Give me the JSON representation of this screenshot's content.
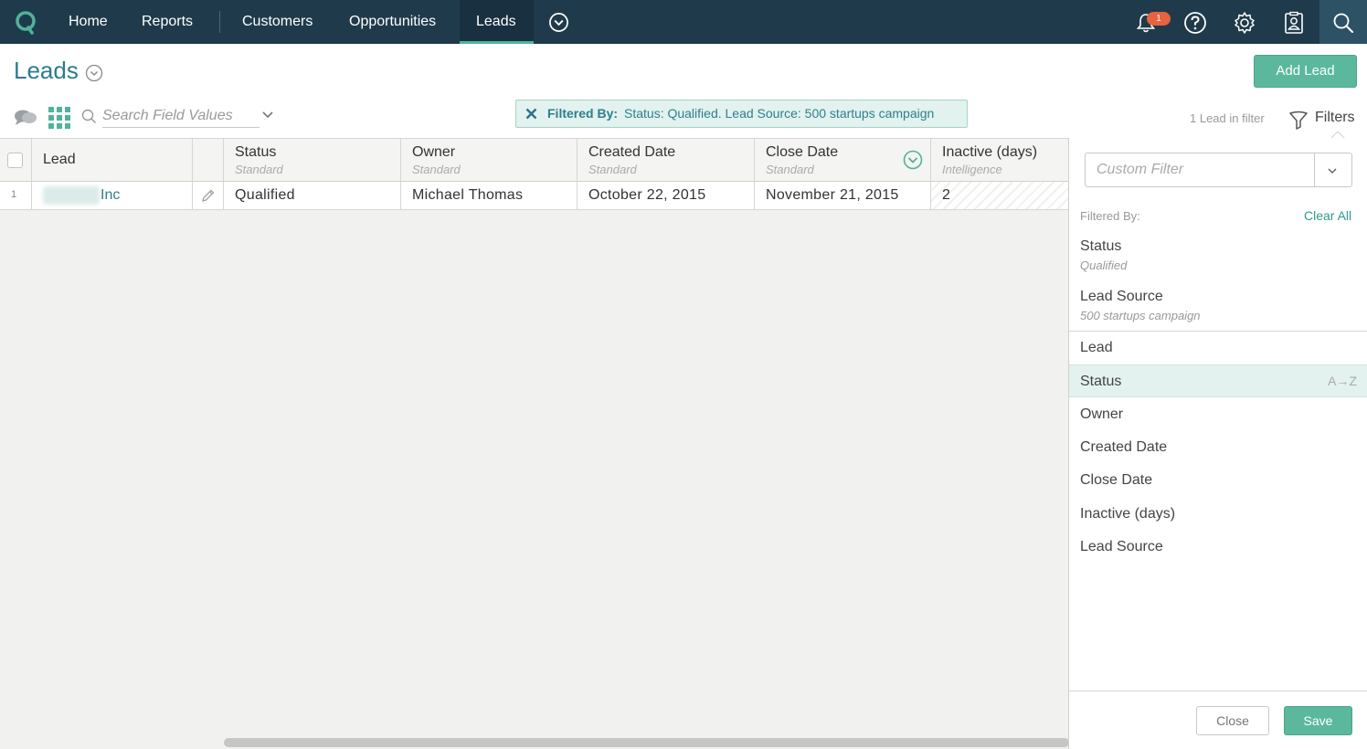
{
  "nav": {
    "items": [
      {
        "label": "Home"
      },
      {
        "label": "Reports"
      },
      {
        "label": "Customers"
      },
      {
        "label": "Opportunities"
      },
      {
        "label": "Leads",
        "active": true
      }
    ],
    "notification_count": "1",
    "icons": [
      "more-icon",
      "bell-icon",
      "help-icon",
      "gear-icon",
      "contact-card-icon",
      "search-icon"
    ]
  },
  "page": {
    "title": "Leads",
    "add_button": "Add Lead"
  },
  "toolbar": {
    "search_placeholder": "Search Field Values",
    "filter_chip_label": "Filtered By:",
    "filter_chip_text": "Status: Qualified. Lead Source: 500 startups campaign",
    "count_text": "1 Lead in filter",
    "filters_label": "Filters"
  },
  "table": {
    "columns": [
      {
        "title": "Lead",
        "sub": ""
      },
      {
        "title": "Status",
        "sub": "Standard"
      },
      {
        "title": "Owner",
        "sub": "Standard"
      },
      {
        "title": "Created Date",
        "sub": "Standard"
      },
      {
        "title": "Close Date",
        "sub": "Standard"
      },
      {
        "title": "Inactive (days)",
        "sub": "Intelligence"
      }
    ],
    "rows": [
      {
        "num": "1",
        "lead": "Inc",
        "status": "Qualified",
        "owner": "Michael Thomas",
        "created": "October 22, 2015",
        "close": "November 21, 2015",
        "inactive": "2"
      }
    ]
  },
  "filter_panel": {
    "custom_filter_placeholder": "Custom Filter",
    "filtered_by_label": "Filtered By:",
    "clear_all": "Clear All",
    "active_filters": [
      {
        "field": "Status",
        "value": "Qualified"
      },
      {
        "field": "Lead Source",
        "value": "500 startups campaign"
      }
    ],
    "columns": [
      "Lead",
      "Status",
      "Owner",
      "Created Date",
      "Close Date",
      "Inactive (days)",
      "Lead Source"
    ],
    "selected_column": "Status",
    "sort_hint": "A→Z",
    "close_label": "Close",
    "save_label": "Save"
  },
  "colors": {
    "nav_bg": "#1f3b4b",
    "accent": "#5bb89c",
    "link": "#2e7f8c",
    "badge": "#e8623f"
  }
}
